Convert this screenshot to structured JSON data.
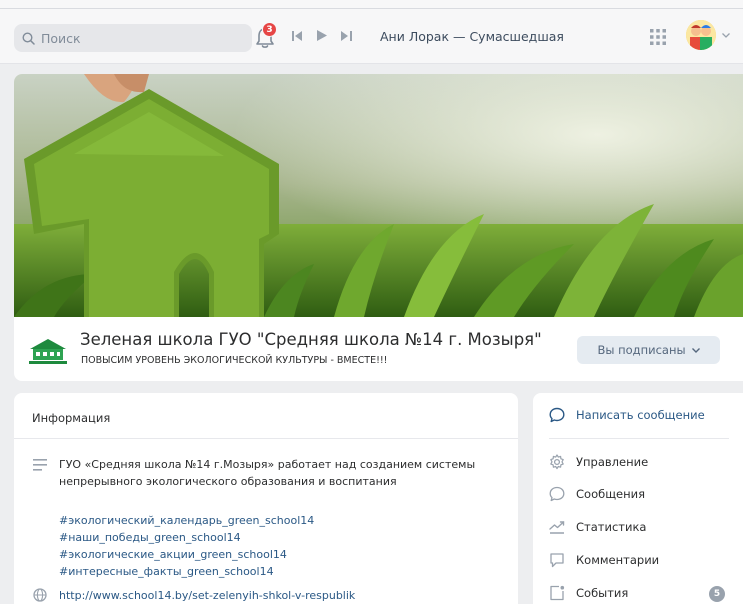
{
  "header": {
    "search_placeholder": "Поиск",
    "notifications_count": "3",
    "now_playing": "Ани Лорак — Сумасшедшая"
  },
  "group": {
    "title": "Зеленая школа ГУО \"Средняя школа №14 г. Мозыря\"",
    "status": "ПОВЫСИМ УРОВЕНЬ ЭКОЛОГИЧЕСКОЙ КУЛЬТУРЫ - ВМЕСТЕ!!!",
    "subscribe_label": "Вы подписаны"
  },
  "info": {
    "heading": "Информация",
    "description": "ГУО «Средняя школа №14 г.Мозыря» работает над созданием системы непрерывного экологического образования и воспитания",
    "hashtags": [
      "#экологический_календарь_green_school14",
      "#наши_победы_green_school14",
      "#экологические_акции_green_school14",
      "#интересные_факты_green_school14"
    ],
    "website": "http://www.school14.by/set-zelenyih-shkol-v-respublik"
  },
  "menu": {
    "write_message": "Написать сообщение",
    "items": [
      {
        "label": "Управление",
        "icon": "gear-icon"
      },
      {
        "label": "Сообщения",
        "icon": "chat-bubble-icon"
      },
      {
        "label": "Статистика",
        "icon": "chart-icon"
      },
      {
        "label": "Комментарии",
        "icon": "comment-icon"
      },
      {
        "label": "События",
        "icon": "events-icon"
      }
    ],
    "events_count": "5"
  },
  "colors": {
    "accent": "#2a5885",
    "badge_red": "#e64646",
    "page_bg": "#edeef0"
  }
}
